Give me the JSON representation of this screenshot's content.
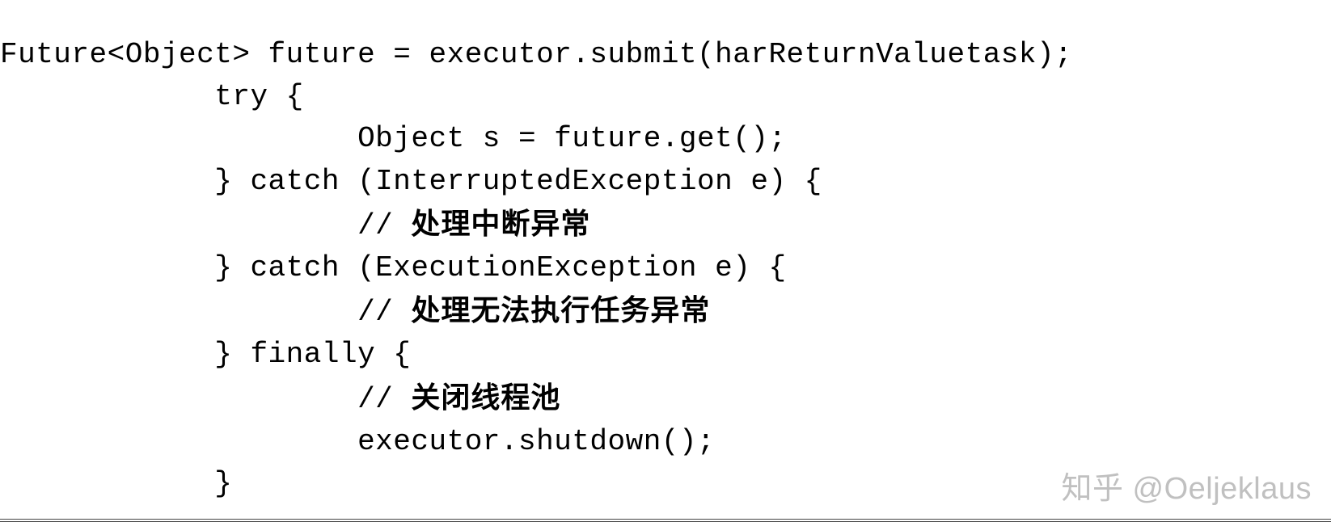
{
  "code": {
    "l1": "Future<Object> future = executor.submit(harReturnValuetask);",
    "l2": "            try {",
    "l3": "                    Object s = future.get();",
    "l4": "            } catch (InterruptedException e) {",
    "l5_prefix": "                    // ",
    "l5_zh": "处理中断异常",
    "l6": "            } catch (ExecutionException e) {",
    "l7_prefix": "                    // ",
    "l7_zh": "处理无法执行任务异常",
    "l8": "            } finally {",
    "l9_prefix": "                    // ",
    "l9_zh": "关闭线程池",
    "l10": "                    executor.shutdown();",
    "l11": "            }"
  },
  "watermark": "知乎 @Oeljeklaus"
}
